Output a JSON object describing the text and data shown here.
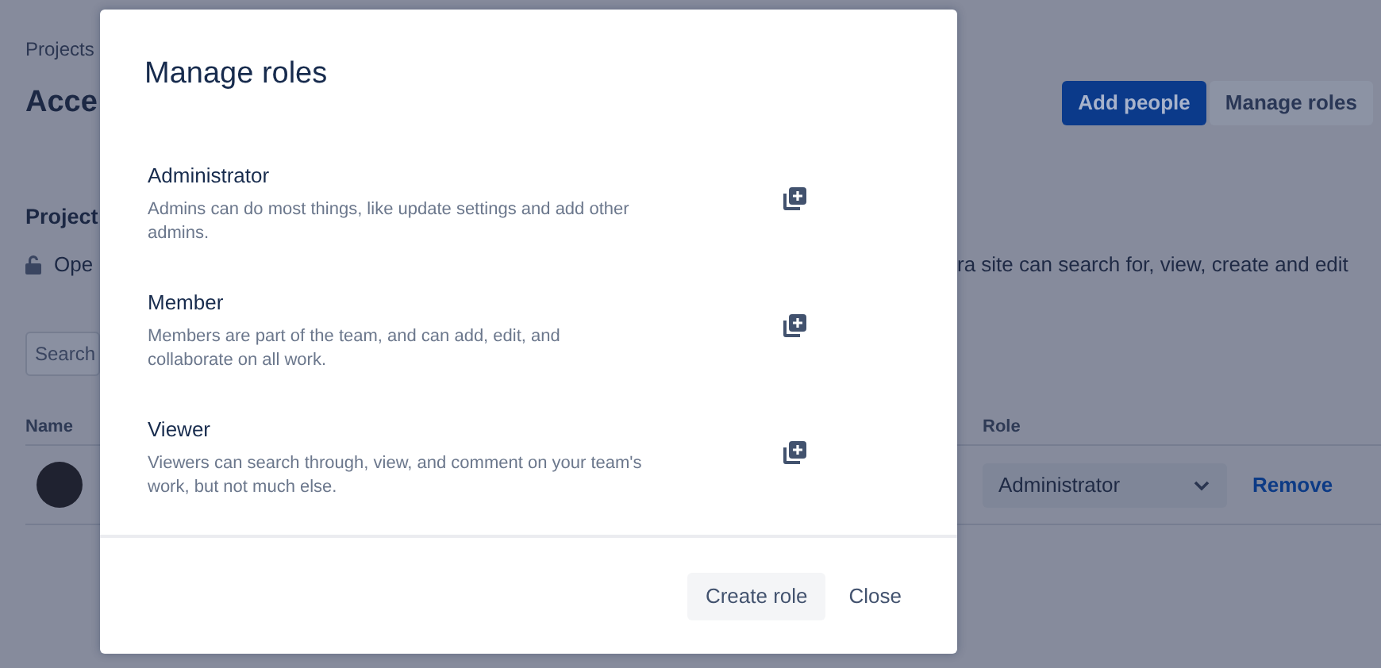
{
  "page": {
    "breadcrumb": "Projects",
    "title": "Acce",
    "buttons": [
      {
        "label": "Add people",
        "kind": "primary"
      },
      {
        "label": "Manage roles",
        "kind": "default"
      }
    ],
    "section_heading": "Project",
    "access_text_start": "Ope",
    "access_text_end": "ra site can search for, view, create and edit",
    "search": {
      "placeholder": "Search"
    },
    "table": {
      "columns": [
        "Name",
        "Role"
      ],
      "rows": [
        {
          "role": "Administrator",
          "action": "Remove"
        }
      ]
    }
  },
  "modal": {
    "title": "Manage roles",
    "roles": [
      {
        "name": "Administrator",
        "description": "Admins can do most things, like update settings and add other admins."
      },
      {
        "name": "Member",
        "description": "Members are part of the team, and can add, edit, and collaborate on all work."
      },
      {
        "name": "Viewer",
        "description": "Viewers can search through, view, and comment on your team's work, but not much else."
      }
    ],
    "buttons": [
      {
        "label": "Create role",
        "kind": "subtle"
      },
      {
        "label": "Close",
        "kind": "link"
      }
    ]
  }
}
